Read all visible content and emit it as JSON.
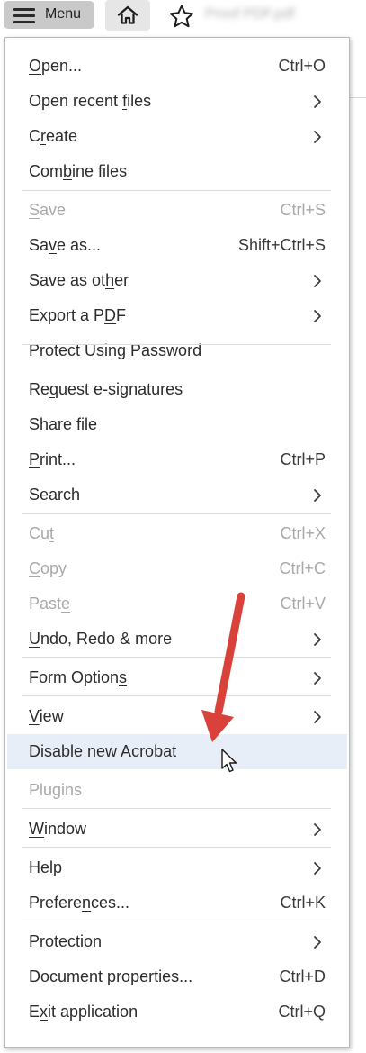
{
  "toolbar": {
    "menu_label": "Menu",
    "file_name": "Proof PDF.pdf",
    "icons": [
      "hamburger-icon",
      "home-icon",
      "star-icon"
    ]
  },
  "menu": {
    "items": [
      {
        "label": "Open...",
        "mnemonic": "O",
        "shortcut": "Ctrl+O",
        "submenu": false,
        "disabled": false
      },
      {
        "label": "Open recent files",
        "mnemonic": "f",
        "shortcut": "",
        "submenu": true,
        "disabled": false
      },
      {
        "label": "Create",
        "mnemonic": "r",
        "shortcut": "",
        "submenu": true,
        "disabled": false
      },
      {
        "label": "Combine files",
        "mnemonic": "b",
        "shortcut": "",
        "submenu": false,
        "disabled": false
      },
      {
        "label": "Save",
        "mnemonic": "S",
        "shortcut": "Ctrl+S",
        "submenu": false,
        "disabled": true
      },
      {
        "label": "Save as...",
        "mnemonic": "v",
        "shortcut": "Shift+Ctrl+S",
        "submenu": false,
        "disabled": false
      },
      {
        "label": "Save as other",
        "mnemonic": "h",
        "shortcut": "",
        "submenu": true,
        "disabled": false
      },
      {
        "label": "Export a PDF",
        "mnemonic": "D",
        "shortcut": "",
        "submenu": true,
        "disabled": false
      },
      {
        "label": "Protect Using Password",
        "mnemonic": "",
        "shortcut": "",
        "submenu": false,
        "disabled": false
      },
      {
        "label": "Request e-signatures",
        "mnemonic": "q",
        "shortcut": "",
        "submenu": false,
        "disabled": false
      },
      {
        "label": "Share file",
        "mnemonic": "",
        "shortcut": "",
        "submenu": false,
        "disabled": false
      },
      {
        "label": "Print...",
        "mnemonic": "P",
        "shortcut": "Ctrl+P",
        "submenu": false,
        "disabled": false
      },
      {
        "label": "Search",
        "mnemonic": "",
        "shortcut": "",
        "submenu": true,
        "disabled": false
      },
      {
        "label": "Cut",
        "mnemonic": "t",
        "shortcut": "Ctrl+X",
        "submenu": false,
        "disabled": true
      },
      {
        "label": "Copy",
        "mnemonic": "C",
        "shortcut": "Ctrl+C",
        "submenu": false,
        "disabled": true
      },
      {
        "label": "Paste",
        "mnemonic": "e",
        "shortcut": "Ctrl+V",
        "submenu": false,
        "disabled": true
      },
      {
        "label": "Undo, Redo & more",
        "mnemonic": "U",
        "shortcut": "",
        "submenu": true,
        "disabled": false
      },
      {
        "label": "Form Options",
        "mnemonic": "s",
        "shortcut": "",
        "submenu": true,
        "disabled": false
      },
      {
        "label": "View",
        "mnemonic": "V",
        "shortcut": "",
        "submenu": true,
        "disabled": false
      },
      {
        "label": "Disable new Acrobat",
        "mnemonic": "",
        "shortcut": "",
        "submenu": false,
        "disabled": false,
        "highlighted": true
      },
      {
        "label": "Plugins",
        "mnemonic": "",
        "shortcut": "",
        "submenu": false,
        "disabled": true
      },
      {
        "label": "Window",
        "mnemonic": "W",
        "shortcut": "",
        "submenu": true,
        "disabled": false
      },
      {
        "label": "Help",
        "mnemonic": "l",
        "shortcut": "",
        "submenu": true,
        "disabled": false
      },
      {
        "label": "Preferences...",
        "mnemonic": "n",
        "shortcut": "Ctrl+K",
        "submenu": false,
        "disabled": false
      },
      {
        "label": "Protection",
        "mnemonic": "",
        "shortcut": "",
        "submenu": true,
        "disabled": false
      },
      {
        "label": "Document properties...",
        "mnemonic": "m",
        "shortcut": "Ctrl+D",
        "submenu": false,
        "disabled": false
      },
      {
        "label": "Exit application",
        "mnemonic": "x",
        "shortcut": "Ctrl+Q",
        "submenu": false,
        "disabled": false
      }
    ]
  },
  "annotation": {
    "arrow_color": "#d9423b",
    "target": "Disable new Acrobat"
  },
  "colors": {
    "menu_button_bg": "#c9c9c9",
    "highlight_bg": "#e8eef8",
    "disabled_text": "#a9a9a9",
    "text": "#2c2c2c"
  }
}
